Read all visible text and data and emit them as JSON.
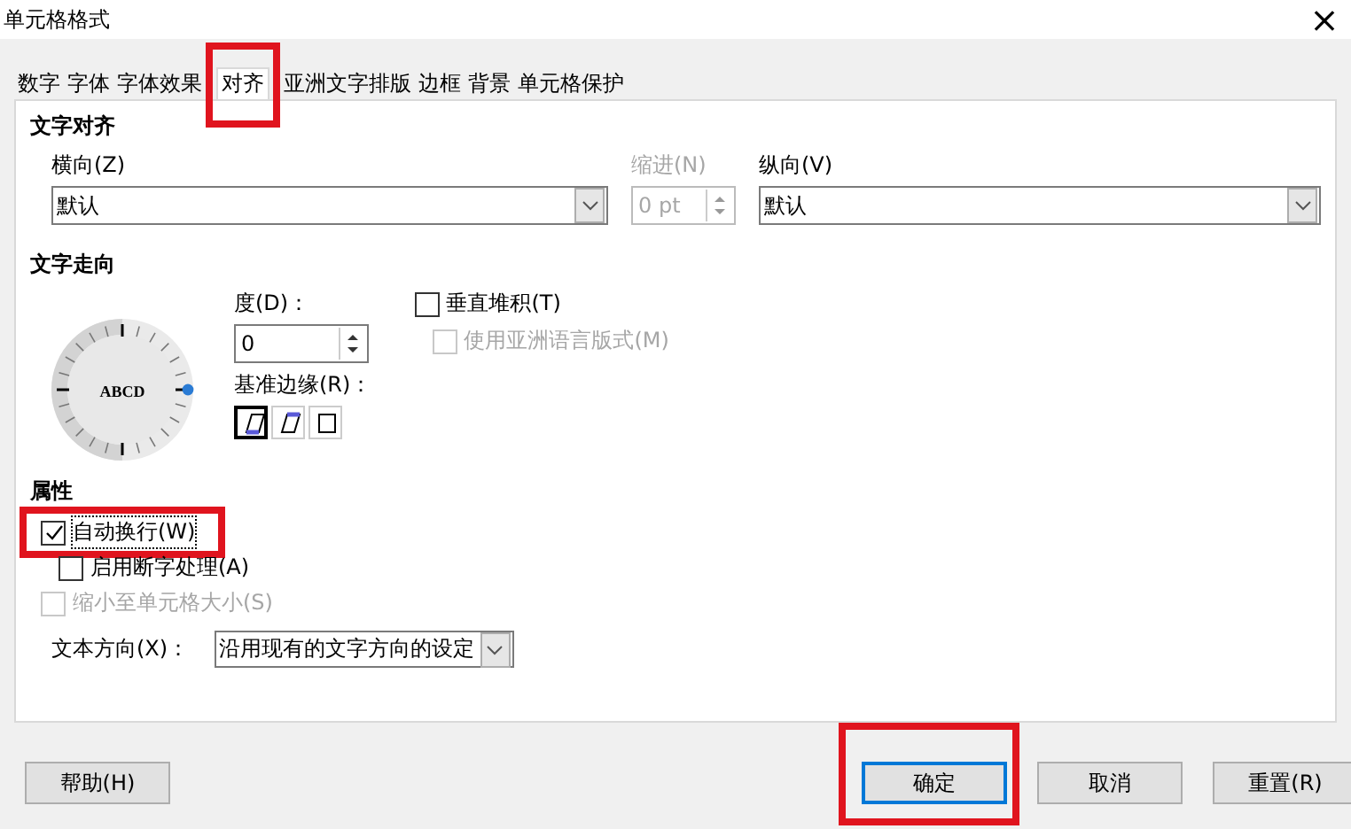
{
  "window": {
    "title": "单元格格式",
    "close": "×"
  },
  "tabs": [
    {
      "label": "数字",
      "selected": false,
      "highlighted": false
    },
    {
      "label": "字体",
      "selected": false,
      "highlighted": false
    },
    {
      "label": "字体效果",
      "selected": false,
      "highlighted": false
    },
    {
      "label": "对齐",
      "selected": true,
      "highlighted": true
    },
    {
      "label": "亚洲文字排版",
      "selected": false,
      "highlighted": false
    },
    {
      "label": "边框",
      "selected": false,
      "highlighted": false
    },
    {
      "label": "背景",
      "selected": false,
      "highlighted": false
    },
    {
      "label": "单元格保护",
      "selected": false,
      "highlighted": false
    }
  ],
  "text_alignment": {
    "heading": "文字对齐",
    "horizontal": {
      "label": "横向(Z)",
      "value": "默认"
    },
    "indent": {
      "label": "缩进(N)",
      "value": "0 pt",
      "disabled": true
    },
    "vertical": {
      "label": "纵向(V)",
      "value": "默认"
    }
  },
  "text_orientation": {
    "heading": "文字走向",
    "dial_text": "ABCD",
    "degrees": {
      "label": "度(D)：",
      "value": "0"
    },
    "reference_edge": {
      "label": "基准边缘(R)：",
      "options": [
        {
          "kind": "bottom",
          "selected": true
        },
        {
          "kind": "top",
          "selected": false
        },
        {
          "kind": "cell",
          "selected": false
        }
      ]
    },
    "checkboxes": [
      {
        "label": "垂直堆积(T)",
        "checked": false,
        "disabled": false
      },
      {
        "label": "使用亚洲语言版式(M)",
        "checked": false,
        "disabled": true
      }
    ]
  },
  "properties": {
    "heading": "属性",
    "checkboxes": [
      {
        "label": "自动换行(W)",
        "checked": true,
        "disabled": false,
        "indented": false,
        "highlighted": true
      },
      {
        "label": "启用断字处理(A)",
        "checked": false,
        "disabled": false,
        "indented": true,
        "highlighted": false
      },
      {
        "label": "缩小至单元格大小(S)",
        "checked": false,
        "disabled": true,
        "indented": false,
        "highlighted": false
      }
    ],
    "text_direction": {
      "label": "文本方向(X)：",
      "value": "沿用现有的文字方向的设定"
    }
  },
  "buttons": [
    {
      "label": "帮助(H)",
      "default": false,
      "highlighted": false
    },
    {
      "label": "确定",
      "default": true,
      "highlighted": true
    },
    {
      "label": "取消",
      "default": false,
      "highlighted": false
    },
    {
      "label": "重置(R)",
      "default": false,
      "highlighted": false
    }
  ]
}
